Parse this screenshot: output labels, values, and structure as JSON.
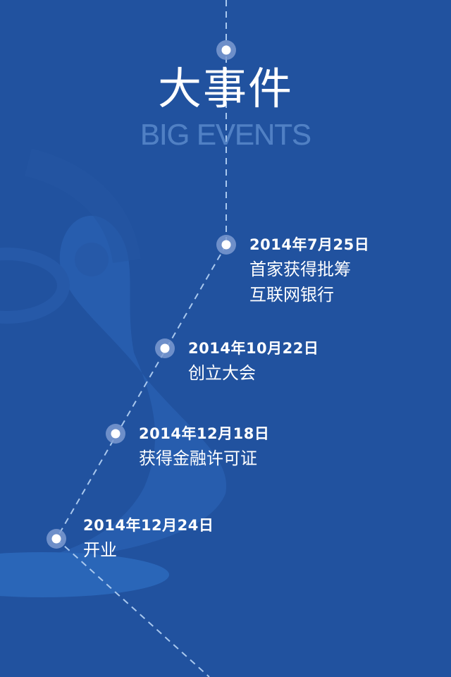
{
  "header": {
    "title": "大事件",
    "subtitle": "BIG EVENTS"
  },
  "events": [
    {
      "date": "2014年7月25日",
      "desc_lines": [
        "首家获得批筹",
        "互联网银行"
      ]
    },
    {
      "date": "2014年10月22日",
      "desc_lines": [
        "创立大会"
      ]
    },
    {
      "date": "2014年12月18日",
      "desc_lines": [
        "获得金融许可证"
      ]
    },
    {
      "date": "2014年12月24日",
      "desc_lines": [
        "开业"
      ]
    }
  ],
  "colors": {
    "background": "#21529f",
    "line": "#a9c8ee",
    "node": "#ffffff"
  }
}
